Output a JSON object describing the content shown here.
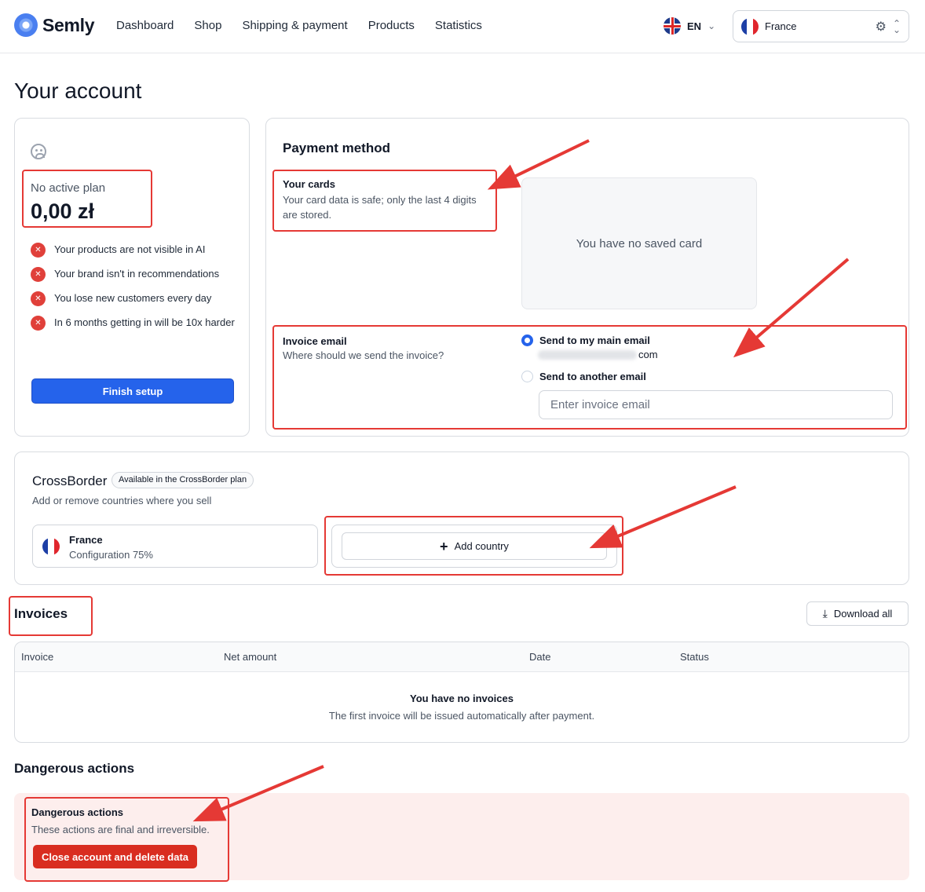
{
  "brand": {
    "name": "Semly"
  },
  "nav": {
    "items": [
      "Dashboard",
      "Shop",
      "Shipping & payment",
      "Products",
      "Statistics"
    ]
  },
  "language": {
    "code": "EN",
    "flag_icon": "uk-flag-icon"
  },
  "country_selector": {
    "value": "France",
    "flag_icon": "france-flag-icon"
  },
  "page": {
    "title": "Your account"
  },
  "plan": {
    "status": "No active plan",
    "amount": "0,00 zł",
    "warnings": [
      "Your products are not visible in AI",
      "Your brand isn't in recommendations",
      "You lose new customers every day",
      "In 6 months getting in will be 10x harder"
    ],
    "cta": "Finish setup"
  },
  "payment": {
    "title": "Payment method",
    "cards_title": "Your cards",
    "cards_desc": "Your card data is safe; only the last 4 digits are stored.",
    "no_card": "You have no saved card",
    "invoice_email_title": "Invoice email",
    "invoice_email_desc": "Where should we send the invoice?",
    "option_main": "Send to my main email",
    "main_email_suffix": "com",
    "option_other": "Send to another email",
    "email_placeholder": "Enter invoice email"
  },
  "crossborder": {
    "title": "CrossBorder",
    "badge": "Available in the CrossBorder plan",
    "desc": "Add or remove countries where you sell",
    "country_name": "France",
    "country_config": "Configuration 75%",
    "add_label": "Add country"
  },
  "invoices": {
    "title": "Invoices",
    "download_label": "Download all",
    "columns": [
      "Invoice",
      "Net amount",
      "Date",
      "Status"
    ],
    "empty_title": "You have no invoices",
    "empty_desc": "The first invoice will be issued automatically after payment."
  },
  "danger": {
    "heading": "Dangerous actions",
    "box_title": "Dangerous actions",
    "box_desc": "These actions are final and irreversible.",
    "button": "Close account and delete data"
  },
  "colors": {
    "primary": "#2563eb",
    "danger": "#d92d20",
    "annotation": "#e53935"
  }
}
